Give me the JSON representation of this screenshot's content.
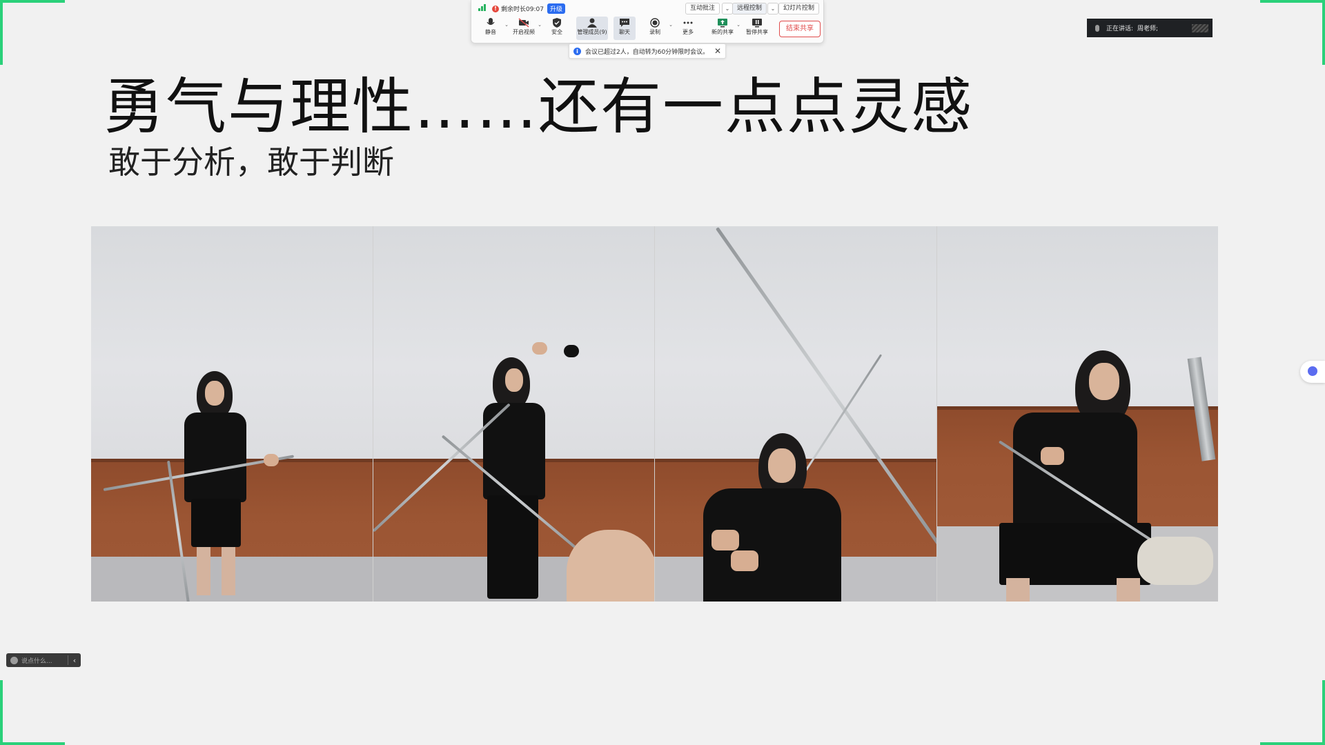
{
  "toolbar": {
    "timer_label": "剩余时长09:07",
    "upgrade_label": "升级",
    "interactive_annotation": "互动批注",
    "remote_control": "远程控制",
    "slide_control": "幻灯片控制",
    "tools": [
      {
        "label": "静音",
        "icon": "microphone-icon"
      },
      {
        "label": "开启视频",
        "icon": "video-off-icon"
      },
      {
        "label": "安全",
        "icon": "shield-icon"
      },
      {
        "label": "管理成员(9)",
        "icon": "members-icon"
      },
      {
        "label": "聊天",
        "icon": "chat-icon"
      },
      {
        "label": "录制",
        "icon": "record-icon"
      },
      {
        "label": "更多",
        "icon": "more-icon"
      },
      {
        "label": "新的共享",
        "icon": "new-share-icon"
      },
      {
        "label": "暂停共享",
        "icon": "pause-share-icon"
      }
    ],
    "end_share": "结束共享"
  },
  "notice": {
    "text": "会议已超过2人，自动转为60分钟限时会议。"
  },
  "speaker": {
    "label": "正在讲话:",
    "name": "周老师;"
  },
  "slide": {
    "title": "勇气与理性……还有一点点灵感",
    "subtitle": "敢于分析，敢于判断"
  },
  "chat": {
    "placeholder": "说点什么..."
  },
  "colors": {
    "share_border": "#2bd17a",
    "upgrade": "#2b6cf0",
    "end_share": "#e04b4b"
  }
}
